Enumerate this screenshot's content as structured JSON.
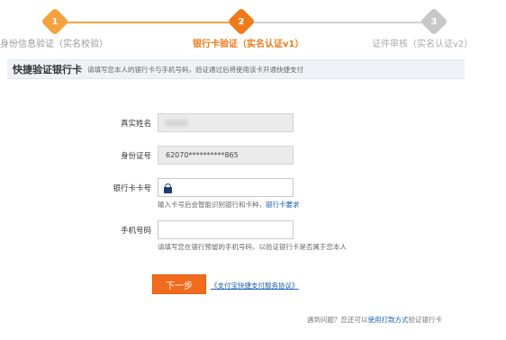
{
  "steps": [
    {
      "number": "1",
      "label": "身份信息验证（实名校验）"
    },
    {
      "number": "2",
      "label": "银行卡验证（实名认证v1）"
    },
    {
      "number": "3",
      "label": "证件审核（实名认证v2）"
    }
  ],
  "section": {
    "title": "快捷验证银行卡",
    "hint": "请填写您本人的银行卡与手机号码，验证通过后将使用该卡开通快捷支付"
  },
  "form": {
    "name_label": "真实姓名",
    "id_label": "身份证号",
    "id_value": "62070**********865",
    "card_label": "银行卡卡号",
    "card_hint": "输入卡号后会智能识别银行和卡种，",
    "card_hint_link": "银行卡要求",
    "phone_label": "手机号码",
    "phone_hint": "请填写您在银行预留的手机号码，以验证银行卡是否属于您本人"
  },
  "actions": {
    "next_label": "下一步",
    "agreement_link": "《支付宝快捷支付服务协议》"
  },
  "footer": {
    "prefix": "遇到问题？您还可以",
    "link": "使用打款方式",
    "suffix": "验证银行卡"
  },
  "colors": {
    "accent": "#f07a1a",
    "link": "#1a5fb4",
    "inactive": "#c8c8c8"
  }
}
